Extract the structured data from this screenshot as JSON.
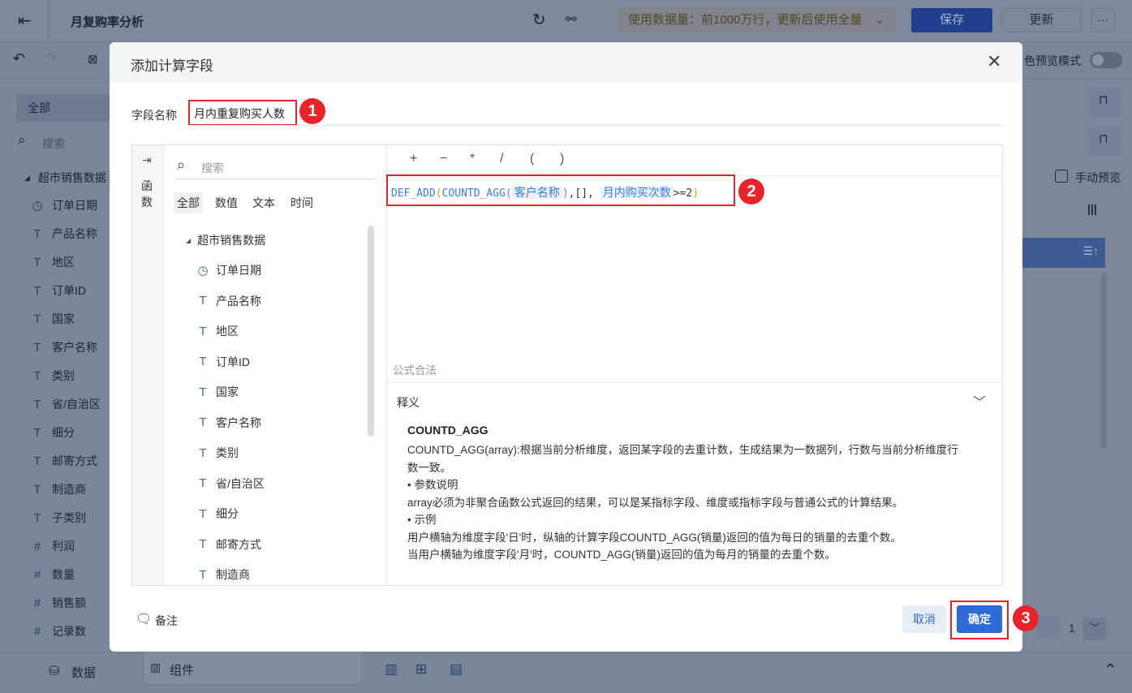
{
  "header": {
    "title": "月复购率分析",
    "data_notice": "使用数据量：前1000万行，更新后使用全量",
    "save": "保存",
    "update": "更新",
    "more": "···"
  },
  "toolbar": {
    "preview_mode": "色预览模式"
  },
  "left_panel": {
    "tab_all": "全部",
    "search_placeholder": "搜索",
    "dataset": "超市销售数据",
    "fields": [
      {
        "label": "订单日期",
        "type": "date"
      },
      {
        "label": "产品名称",
        "type": "text"
      },
      {
        "label": "地区",
        "type": "text"
      },
      {
        "label": "订单ID",
        "type": "text"
      },
      {
        "label": "国家",
        "type": "text"
      },
      {
        "label": "客户名称",
        "type": "text"
      },
      {
        "label": "类别",
        "type": "text"
      },
      {
        "label": "省/自治区",
        "type": "text"
      },
      {
        "label": "细分",
        "type": "text"
      },
      {
        "label": "邮寄方式",
        "type": "text"
      },
      {
        "label": "制造商",
        "type": "text"
      },
      {
        "label": "子类别",
        "type": "text"
      },
      {
        "label": "利润",
        "type": "number"
      },
      {
        "label": "数量",
        "type": "number"
      },
      {
        "label": "销售额",
        "type": "number"
      },
      {
        "label": "记录数",
        "type": "number"
      }
    ]
  },
  "right_panel": {
    "manual_preview": "手动预览",
    "page": "1"
  },
  "bottom": {
    "data_tab": "数据",
    "component_tab": "组件"
  },
  "modal": {
    "title": "添加计算字段",
    "field_name_label": "字段名称",
    "field_name_value": "月内重复购买人数",
    "function_tab": "函数",
    "search_placeholder": "搜索",
    "filter_tabs": [
      "全部",
      "数值",
      "文本",
      "时间"
    ],
    "dataset": "超市销售数据",
    "fields": [
      {
        "label": "订单日期",
        "type": "date"
      },
      {
        "label": "产品名称",
        "type": "text"
      },
      {
        "label": "地区",
        "type": "text"
      },
      {
        "label": "订单ID",
        "type": "text"
      },
      {
        "label": "国家",
        "type": "text"
      },
      {
        "label": "客户名称",
        "type": "text"
      },
      {
        "label": "类别",
        "type": "text"
      },
      {
        "label": "省/自治区",
        "type": "text"
      },
      {
        "label": "细分",
        "type": "text"
      },
      {
        "label": "邮寄方式",
        "type": "text"
      },
      {
        "label": "制造商",
        "type": "text"
      }
    ],
    "operators": [
      "+",
      "−",
      "*",
      "/",
      "(",
      ")"
    ],
    "formula": {
      "fn1": "DEF_ADD",
      "open1": "(",
      "fn2": "COUNTD_AGG",
      "open2": "(",
      "field1": "客户名称",
      "close2": ")",
      "mid": ",[], ",
      "field2": "月内购买次数",
      "tail": ">=2",
      "close1": ")"
    },
    "status": "公式合法",
    "desc_title": "释义",
    "desc": {
      "name": "COUNTD_AGG",
      "lines": [
        "COUNTD_AGG(array):根据当前分析维度，返回某字段的去重计数，生成结果为一数据列，行数与当前分析维度行数一致。",
        "• 参数说明",
        "array必须为非聚合函数公式返回的结果，可以是某指标字段、维度或指标字段与普通公式的计算结果。",
        "• 示例",
        "用户横轴为维度字段'日'时，纵轴的计算字段COUNTD_AGG(销量)返回的值为每日的销量的去重个数。",
        "当用户横轴为维度字段'月'时，COUNTD_AGG(销量)返回的值为每月的销量的去重个数。"
      ]
    },
    "note": "备注",
    "cancel": "取消",
    "confirm": "确定",
    "badges": [
      "1",
      "2",
      "3"
    ]
  }
}
